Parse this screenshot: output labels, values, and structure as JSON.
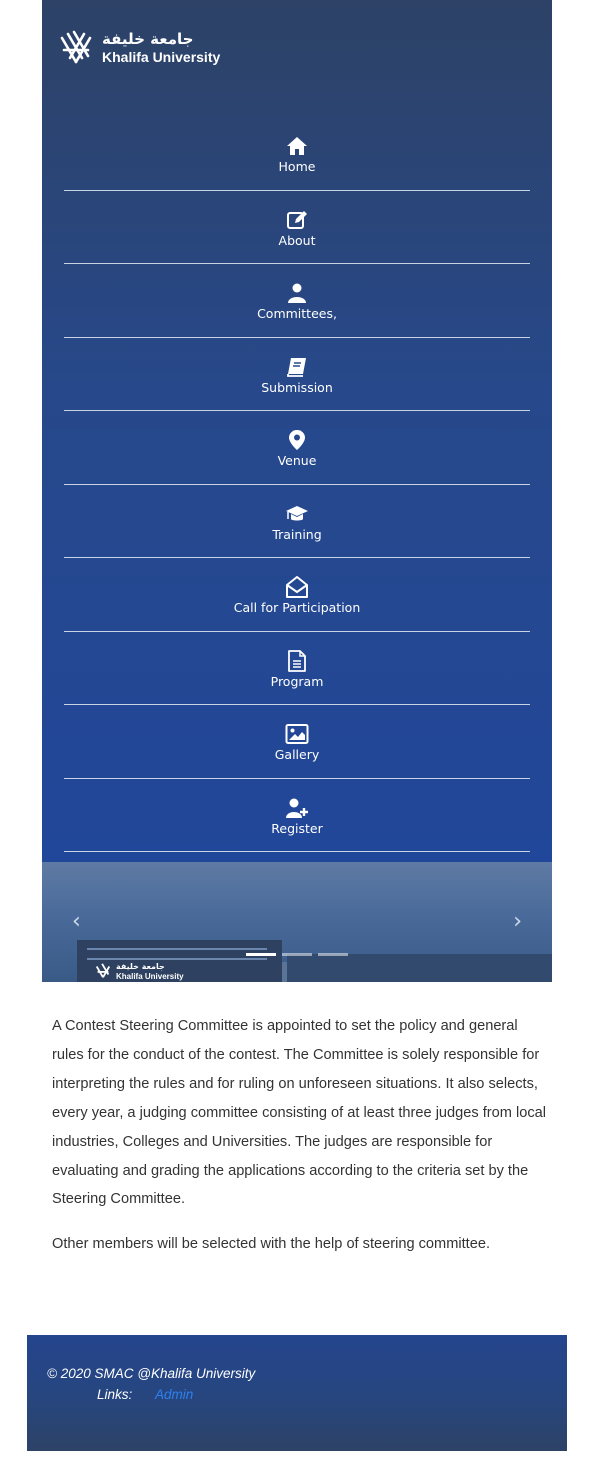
{
  "header": {
    "logo_arabic": "جامعة خليفة",
    "logo_english": "Khalifa University"
  },
  "nav": {
    "items": [
      {
        "label": "Home",
        "icon": "home-icon"
      },
      {
        "label": "About",
        "icon": "edit-icon"
      },
      {
        "label": "Committees,",
        "icon": "user-icon"
      },
      {
        "label": "Submission",
        "icon": "book-icon"
      },
      {
        "label": "Venue",
        "icon": "map-marker-icon"
      },
      {
        "label": "Training",
        "icon": "graduation-cap-icon"
      },
      {
        "label": "Call for Participation",
        "icon": "envelope-open-icon"
      },
      {
        "label": "Program",
        "icon": "file-text-icon"
      },
      {
        "label": "Gallery",
        "icon": "image-icon"
      },
      {
        "label": "Register",
        "icon": "user-plus-icon"
      }
    ]
  },
  "carousel": {
    "prev_label": "‹",
    "next_label": "›",
    "slide_count": 3,
    "active_index": 0,
    "image_logo_arabic": "جامعة خليفة",
    "image_logo_english": "Khalifa University"
  },
  "content": {
    "paragraphs": [
      "A Contest Steering Committee is appointed to set the policy and general rules for the conduct of the contest. The Committee is solely responsible for interpreting the rules and for ruling on unforeseen situations. It also selects, every year, a judging committee consisting of at least three judges from local industries, Colleges and Universities. The judges are responsible for evaluating and grading the applications according to the criteria set by the Steering Committee.",
      "Other members will be selected with the help of steering committee."
    ]
  },
  "footer": {
    "copyright": "© 2020 SMAC @Khalifa University",
    "links_label": "Links:",
    "admin_link": "Admin"
  },
  "colors": {
    "header_top": "#2d4266",
    "header_bottom": "#21479a",
    "link": "#2f80ed",
    "text": "#333333"
  }
}
